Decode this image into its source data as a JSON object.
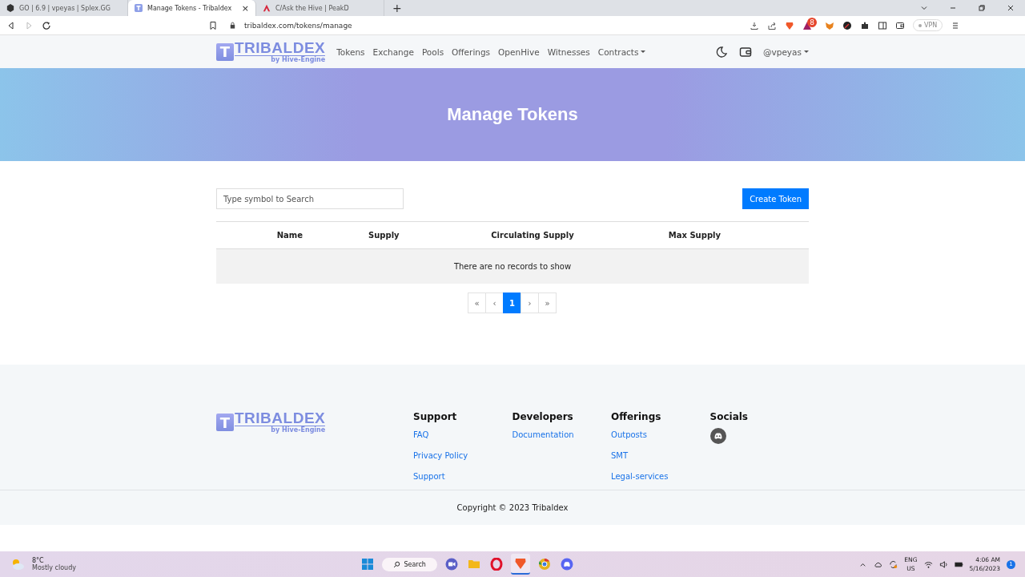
{
  "browser": {
    "tabs": [
      {
        "title": "GO | 6.9 | vpeyas | Splex.GG",
        "selected": false
      },
      {
        "title": "Manage Tokens - Tribaldex",
        "selected": true,
        "close": "×"
      },
      {
        "title": "C/Ask the Hive | PeakD",
        "selected": false
      }
    ],
    "new_tab": "+",
    "url": "tribaldex.com/tokens/manage",
    "rewards_badge": "8",
    "vpn": "VPN"
  },
  "site_nav": {
    "logo": {
      "letter": "T",
      "name": "TRIBALDEX",
      "byline": "by Hive-Engine"
    },
    "links": [
      {
        "label": "Tokens",
        "dropdown": false
      },
      {
        "label": "Exchange",
        "dropdown": false
      },
      {
        "label": "Pools",
        "dropdown": false
      },
      {
        "label": "Offerings",
        "dropdown": false
      },
      {
        "label": "OpenHive",
        "dropdown": false
      },
      {
        "label": "Witnesses",
        "dropdown": false
      },
      {
        "label": "Contracts",
        "dropdown": true
      }
    ],
    "user": "@vpeyas"
  },
  "hero": {
    "title": "Manage Tokens"
  },
  "search": {
    "placeholder": "Type symbol to Search"
  },
  "create_button": "Create Token",
  "table": {
    "columns": [
      "Name",
      "Supply",
      "Circulating Supply",
      "Max Supply"
    ],
    "empty_message": "There are no records to show"
  },
  "pagination": [
    {
      "label": "«",
      "selected": false
    },
    {
      "label": "‹",
      "selected": false
    },
    {
      "label": "1",
      "selected": true
    },
    {
      "label": "›",
      "selected": false
    },
    {
      "label": "»",
      "selected": false
    }
  ],
  "footer": {
    "logo": {
      "letter": "T",
      "name": "TRIBALDEX",
      "byline": "by Hive-Engine"
    },
    "columns": [
      {
        "heading": "Support",
        "kind": "links",
        "links": [
          "FAQ",
          "Privacy Policy",
          "Support"
        ]
      },
      {
        "heading": "Developers",
        "kind": "links",
        "links": [
          "Documentation"
        ]
      },
      {
        "heading": "Offerings",
        "kind": "links",
        "links": [
          "Outposts",
          "SMT",
          "Legal-services"
        ]
      },
      {
        "heading": "Socials",
        "kind": "socials"
      }
    ],
    "copyright": "Copyright © 2023 Tribaldex"
  },
  "taskbar": {
    "weather": {
      "temp": "8°C",
      "condition": "Mostly cloudy"
    },
    "search": "Search",
    "lang": "ENG",
    "region": "US",
    "time": "4:06 AM",
    "date": "5/16/2023",
    "notifications": "1"
  }
}
